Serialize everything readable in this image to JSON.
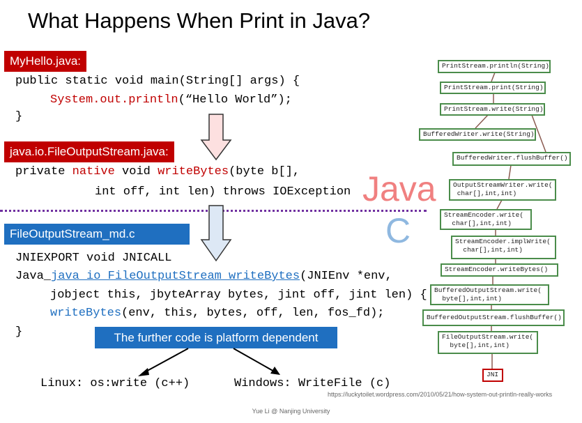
{
  "title": "What Happens When Print in Java?",
  "sections": {
    "hello": {
      "label": "MyHello.java:",
      "lines": [
        "public static void main(String[] args) {",
        "System.out.println",
        "(“Hello World”);",
        "}"
      ]
    },
    "fos": {
      "label": "java.io.FileOutputStream.java:",
      "l1a": "private ",
      "l1b": "native",
      "l1c": " void ",
      "l1d": "writeBytes",
      "l1e": "(byte b[],",
      "l2": "int off, int len) throws IOException"
    },
    "md": {
      "label": "FileOutputStream_md.c",
      "l1": "JNIEXPORT void JNICALL",
      "l2a": "Java_",
      "l2b": "java_io_FileOutputStream_writeBytes",
      "l2c": "(JNIEnv *env,",
      "l3": "jobject this, jbyteArray bytes, jint off, jint len) {",
      "l4a": "writeBytes",
      "l4b": "(env, this, bytes, off, len, fos_fd);",
      "l5": "}"
    }
  },
  "java_label": "Java",
  "c_label": "C",
  "banner": "The further code is platform dependent",
  "linux": "Linux: os:write (c++)",
  "windows": "Windows: WriteFile (c)",
  "call_chain": [
    "PrintStream.println(String)",
    "PrintStream.print(String)",
    "PrintStream.write(String)",
    "BufferedWriter.write(String)",
    "BufferedWriter.flushBuffer()",
    "OutputStreamWriter.write(\n char[],int,int)",
    "StreamEncoder.write(\n  char[],int,int)",
    "StreamEncoder.implWrite(\n  char[],int,int)",
    "StreamEncoder.writeBytes()",
    "BufferedOutputStream.write(\n  byte[],int,int)",
    "BufferedOutputStream.flushBuffer()",
    "FileOutputStream.write(\n  byte[],int,int)",
    "JNI"
  ],
  "source_url": "https://luckytoilet.wordpress.com/2010/05/21/how-system-out-println-really-works",
  "footer": "Yue Li @ Nanjing University",
  "colors": {
    "label_red": "#c00000",
    "label_blue": "#1f6fc0",
    "box_border": "#4a8c4a",
    "divider": "#7030a0"
  }
}
